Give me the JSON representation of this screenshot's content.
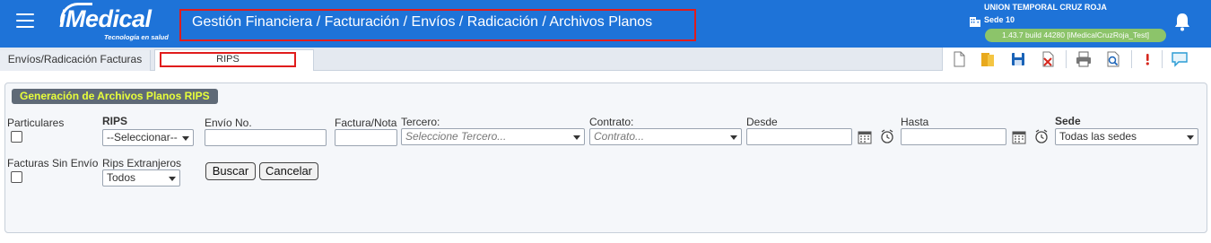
{
  "header": {
    "logo_text": "iMedical",
    "logo_tagline": "Tecnología en salud",
    "breadcrumb": "Gestión Financiera  /  Facturación  /  Envíos / Radicación / Archivos Planos",
    "organization": "UNION TEMPORAL CRUZ ROJA",
    "sede": "Sede 10",
    "build": "1.43.7 build 44280 [iMedicalCruzRoja_Test]"
  },
  "tabs": [
    {
      "label": "Envíos/Radicación Facturas"
    },
    {
      "label": "RIPS"
    }
  ],
  "toolbar": {
    "icons": [
      "new-document-icon",
      "open-folder-icon",
      "save-icon",
      "delete-icon",
      "print-icon",
      "preview-icon",
      "help-icon",
      "comment-icon"
    ]
  },
  "form": {
    "title": "Generación de Archivos Planos RIPS",
    "particulares_label": "Particulares",
    "rips_label": "RIPS",
    "rips_value": "--Seleccionar--",
    "envio_label": "Envío No.",
    "envio_value": "",
    "factura_label": "Factura/Nota",
    "factura_value": "",
    "tercero_label": "Tercero:",
    "tercero_placeholder": "Seleccione Tercero...",
    "contrato_label": "Contrato:",
    "contrato_placeholder": "Contrato...",
    "desde_label": "Desde",
    "desde_value": "",
    "hasta_label": "Hasta",
    "hasta_value": "",
    "sede_label": "Sede",
    "sede_value": "Todas las sedes",
    "facturas_sin_envio_label": "Facturas Sin Envío",
    "rips_extranjeros_label": "Rips Extranjeros",
    "rips_extranjeros_value": "Todos",
    "buscar_label": "Buscar",
    "cancelar_label": "Cancelar"
  }
}
